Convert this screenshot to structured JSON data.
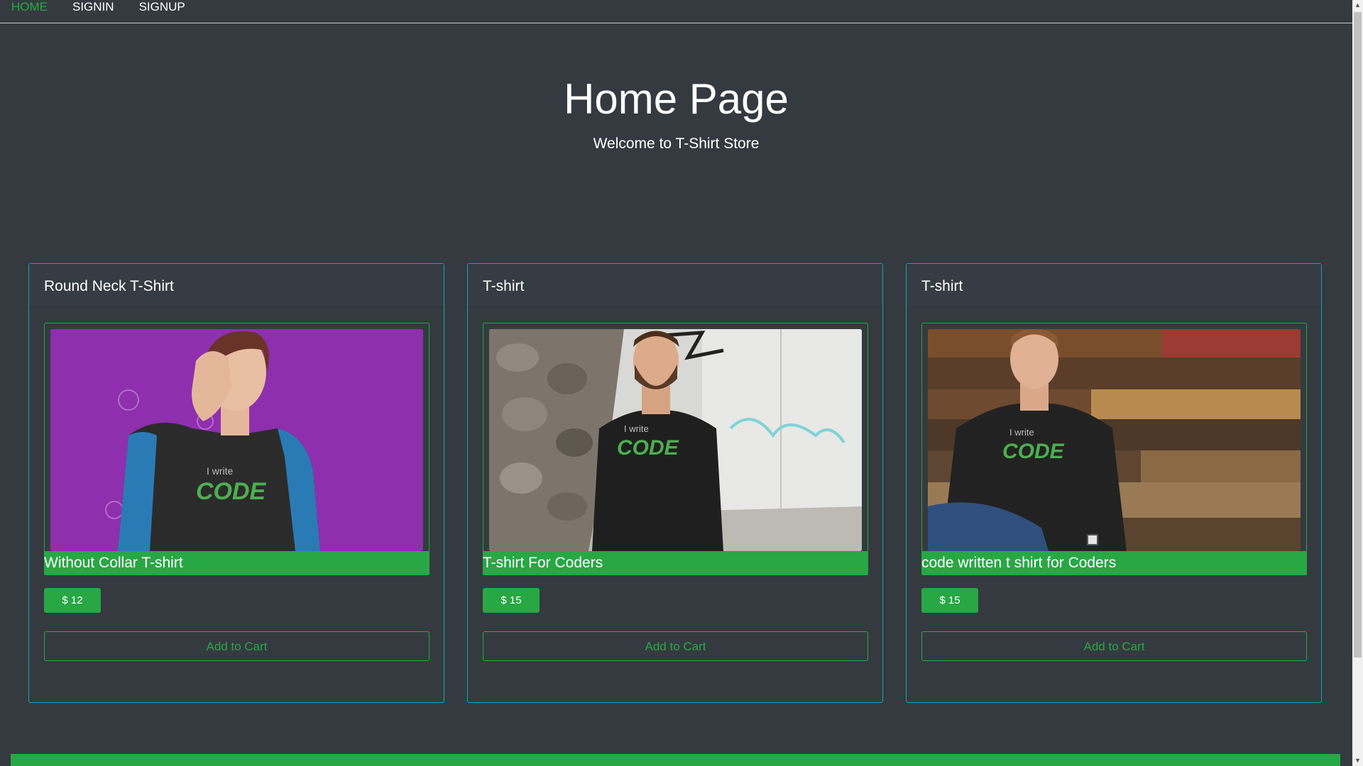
{
  "nav": {
    "items": [
      {
        "label": "HOME",
        "active": true
      },
      {
        "label": "SIGNIN",
        "active": false
      },
      {
        "label": "SIGNUP",
        "active": false
      }
    ]
  },
  "hero": {
    "title": "Home Page",
    "subtitle": "Welcome to T-Shirt Store"
  },
  "products": [
    {
      "header": "Round Neck T-Shirt",
      "name": "Without Collar T-shirt",
      "price": "$ 12",
      "cart_label": "Add to Cart",
      "image_bg": "#8e2fad"
    },
    {
      "header": "T-shirt",
      "name": "T-shirt For Coders",
      "price": "$ 15",
      "cart_label": "Add to Cart",
      "image_bg": "#d8d8d6"
    },
    {
      "header": "T-shirt",
      "name": "code written t shirt for Coders",
      "price": "$ 15",
      "cart_label": "Add to Cart",
      "image_bg": "#6b4a2f"
    }
  ],
  "shirt_print": {
    "line1": "I write",
    "line2": "CODE"
  },
  "colors": {
    "background": "#343a40",
    "accent": "#28a745",
    "card_border": "#17a2b8",
    "text": "#ffffff"
  }
}
